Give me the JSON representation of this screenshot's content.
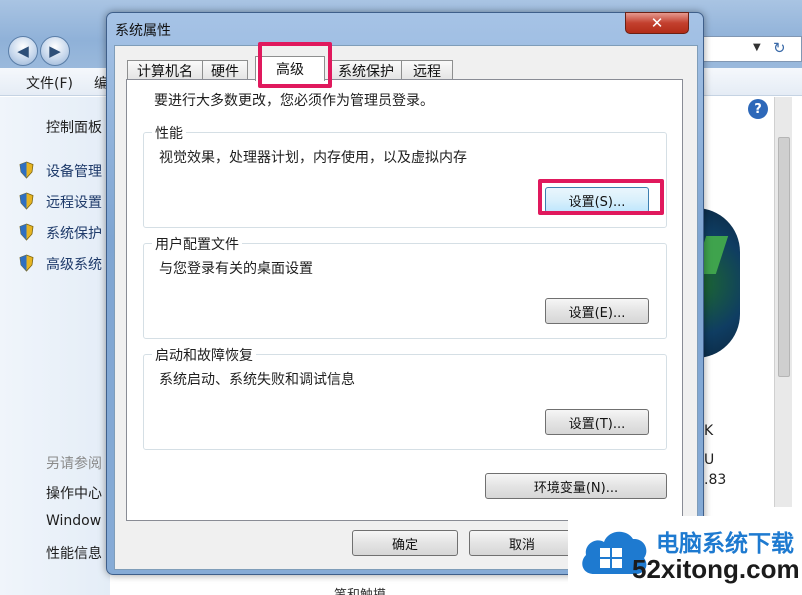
{
  "background": {
    "menu_file": "文件(F)",
    "menu_fragment": "编",
    "sidebar": {
      "home": "控制面板",
      "items": [
        "设备管理",
        "远程设置",
        "系统保护",
        "高级系统"
      ],
      "see_also": "另请参阅",
      "links": [
        "操作中心",
        "Window",
        "性能信息"
      ]
    },
    "right_fragments": [
      "K",
      "U",
      ".83"
    ],
    "bottom_fragment": "笔和触摸"
  },
  "dialog": {
    "title": "系统属性",
    "close_glyph": "✕",
    "tabs": [
      {
        "label": "计算机名"
      },
      {
        "label": "硬件"
      },
      {
        "label": "高级"
      },
      {
        "label": "系统保护"
      },
      {
        "label": "远程"
      }
    ],
    "active_tab": "高级",
    "admin_note": "要进行大多数更改，您必须作为管理员登录。",
    "groups": [
      {
        "title": "性能",
        "desc": "视觉效果，处理器计划，内存使用，以及虚拟内存",
        "button": "设置(S)..."
      },
      {
        "title": "用户配置文件",
        "desc": "与您登录有关的桌面设置",
        "button": "设置(E)..."
      },
      {
        "title": "启动和故障恢复",
        "desc": "系统启动、系统失败和调试信息",
        "button": "设置(T)..."
      }
    ],
    "env_button": "环境变量(N)...",
    "ok_button": "确定",
    "cancel_button": "取消"
  },
  "watermark": {
    "title": "电脑系统下载",
    "url": "52xitong.com"
  },
  "colors": {
    "highlight": "#e0195d",
    "watermark_blue": "#1e7ad0"
  }
}
